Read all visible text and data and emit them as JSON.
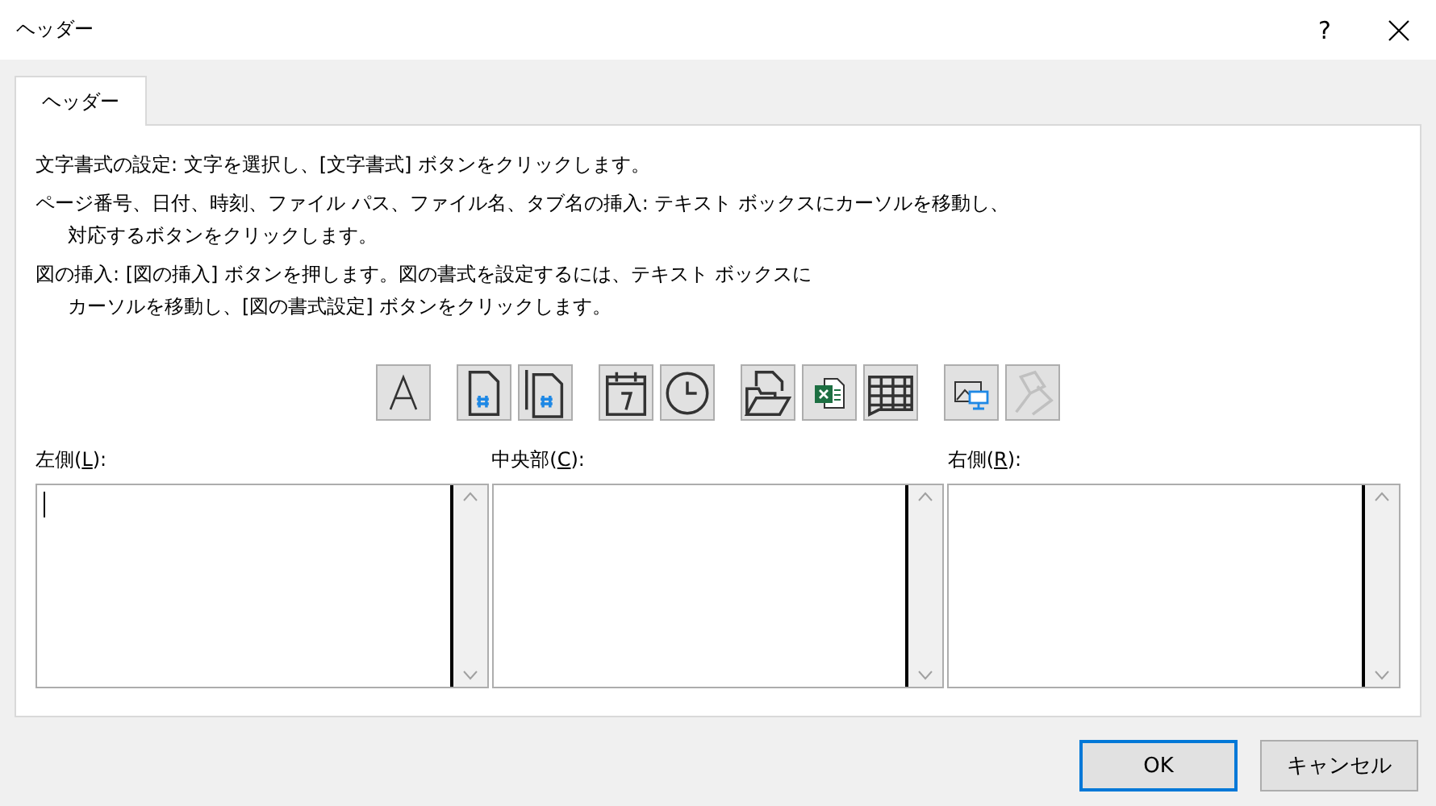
{
  "window": {
    "title": "ヘッダー",
    "help": "?"
  },
  "tabs": [
    {
      "label": "ヘッダー",
      "selected": true
    }
  ],
  "instructions": [
    {
      "lines": [
        "文字書式の設定: 文字を選択し、[文字書式] ボタンをクリックします。"
      ]
    },
    {
      "lines": [
        "ページ番号、日付、時刻、ファイル パス、ファイル名、タブ名の挿入: テキスト ボックスにカーソルを移動し、",
        "対応するボタンをクリックします。"
      ]
    },
    {
      "lines": [
        "図の挿入: [図の挿入] ボタンを押します。図の書式を設定するには、テキスト ボックスに",
        "カーソルを移動し、[図の書式設定] ボタンをクリックします。"
      ]
    }
  ],
  "toolbar": [
    [
      {
        "kind": "font",
        "disabled": false
      }
    ],
    [
      {
        "kind": "page-number",
        "disabled": false
      },
      {
        "kind": "page-count",
        "disabled": false
      }
    ],
    [
      {
        "kind": "date",
        "disabled": false
      },
      {
        "kind": "time",
        "disabled": false
      }
    ],
    [
      {
        "kind": "file-path",
        "disabled": false
      },
      {
        "kind": "file-name",
        "disabled": false
      },
      {
        "kind": "sheet-name",
        "disabled": false
      }
    ],
    [
      {
        "kind": "picture",
        "disabled": false
      },
      {
        "kind": "format-picture",
        "disabled": true
      }
    ]
  ],
  "sections": [
    {
      "label": {
        "before": "左側(",
        "key": "L",
        "after": "):"
      },
      "focused": true
    },
    {
      "label": {
        "before": "中央部(",
        "key": "C",
        "after": "):"
      },
      "focused": false
    },
    {
      "label": {
        "before": "右側(",
        "key": "R",
        "after": "):"
      },
      "focused": false
    }
  ],
  "buttons": [
    {
      "label": "OK",
      "default": true
    },
    {
      "label": "キャンセル",
      "default": false
    }
  ]
}
